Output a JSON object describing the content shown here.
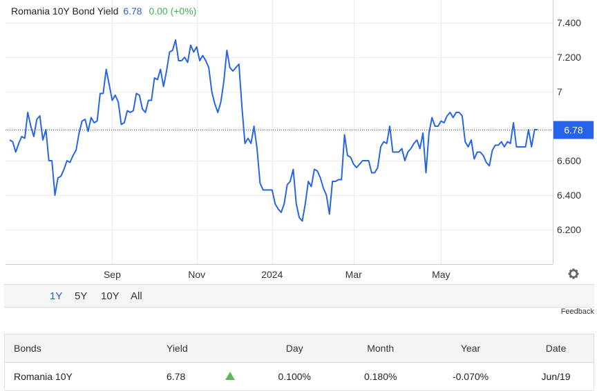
{
  "chart_data": {
    "type": "line",
    "title": "Romania 10Y Bond Yield",
    "last_value": "6.78",
    "change": "0.00 (+0%)",
    "current_label": "6.78",
    "ylim": [
      6.0,
      7.4
    ],
    "y_ticks": [
      6.2,
      6.4,
      6.6,
      7.0,
      7.2,
      7.4
    ],
    "y_tick_labels": [
      "6.200",
      "6.400",
      "6.600",
      "7",
      "7.200",
      "7.400"
    ],
    "x_ticks": [
      {
        "label": "Sep",
        "index": 34
      },
      {
        "label": "Nov",
        "index": 62
      },
      {
        "label": "2024",
        "index": 87
      },
      {
        "label": "Mar",
        "index": 114
      },
      {
        "label": "May",
        "index": 143
      }
    ],
    "grid": true,
    "series": [
      {
        "values": [
          6.72,
          6.71,
          6.65,
          6.7,
          6.74,
          6.73,
          6.88,
          6.8,
          6.74,
          6.84,
          6.86,
          6.72,
          6.78,
          6.6,
          6.6,
          6.4,
          6.5,
          6.51,
          6.55,
          6.6,
          6.59,
          6.63,
          6.66,
          6.76,
          6.83,
          6.84,
          6.77,
          6.85,
          6.82,
          6.83,
          6.99,
          6.99,
          7.13,
          7.04,
          6.95,
          6.98,
          6.94,
          6.81,
          6.82,
          6.89,
          6.88,
          6.89,
          6.99,
          6.98,
          6.9,
          6.88,
          6.95,
          6.95,
          7.08,
          7.07,
          7.13,
          7.03,
          7.12,
          7.23,
          7.24,
          7.3,
          7.18,
          7.18,
          7.2,
          7.17,
          7.27,
          7.23,
          7.26,
          7.18,
          7.21,
          7.18,
          7.14,
          7.0,
          6.93,
          6.88,
          6.94,
          7.06,
          7.24,
          7.14,
          7.12,
          7.14,
          7.16,
          6.91,
          6.7,
          6.73,
          6.7,
          6.8,
          6.67,
          6.47,
          6.43,
          6.43,
          6.43,
          6.43,
          6.35,
          6.32,
          6.3,
          6.35,
          6.46,
          6.48,
          6.55,
          6.35,
          6.27,
          6.25,
          6.35,
          6.48,
          6.45,
          6.55,
          6.54,
          6.5,
          6.44,
          6.4,
          6.29,
          6.48,
          6.48,
          6.49,
          6.49,
          6.75,
          6.63,
          6.62,
          6.58,
          6.56,
          6.58,
          6.6,
          6.6,
          6.6,
          6.53,
          6.53,
          6.56,
          6.68,
          6.71,
          6.7,
          6.8,
          6.65,
          6.65,
          6.65,
          6.67,
          6.6,
          6.65,
          6.67,
          6.7,
          6.72,
          6.67,
          6.76,
          6.53,
          6.76,
          6.85,
          6.8,
          6.8,
          6.83,
          6.82,
          6.86,
          6.88,
          6.85,
          6.88,
          6.88,
          6.86,
          6.71,
          6.68,
          6.72,
          6.61,
          6.65,
          6.65,
          6.63,
          6.59,
          6.57,
          6.66,
          6.69,
          6.69,
          6.71,
          6.68,
          6.71,
          6.7,
          6.82,
          6.68,
          6.68,
          6.68,
          6.68,
          6.78,
          6.68,
          6.78,
          6.78
        ]
      }
    ]
  },
  "range_buttons": [
    "1Y",
    "5Y",
    "10Y",
    "All"
  ],
  "active_range": "1Y",
  "feedback_label": "Feedback",
  "table": {
    "headers": [
      "Bonds",
      "Yield",
      "",
      "Day",
      "Month",
      "Year",
      "Date"
    ],
    "rows": [
      {
        "name": "Romania 10Y",
        "yield": "6.78",
        "trend": "up",
        "day": "0.100%",
        "month": "0.180%",
        "year": "-0.070%",
        "date": "Jun/19"
      }
    ]
  },
  "colors": {
    "line": "#2563eb",
    "accent": "#2a5bd7",
    "positive": "#3bb54a",
    "up_arrow": "#5cb85c"
  },
  "icons": {
    "settings": "gear-icon"
  }
}
